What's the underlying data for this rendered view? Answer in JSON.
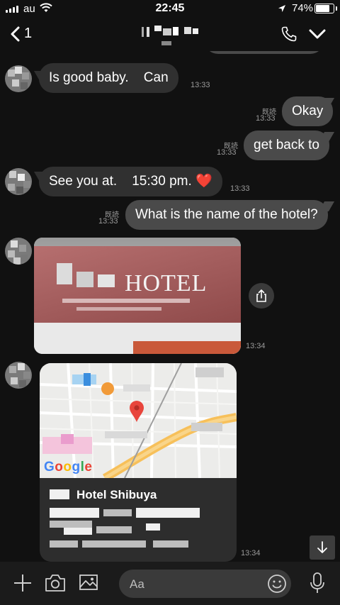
{
  "status_bar": {
    "carrier": "au",
    "time": "22:45",
    "battery": "74%"
  },
  "header": {
    "back_count": "1"
  },
  "messages": [
    {
      "side": "in",
      "text": "Is good baby.    Can",
      "time": "13:33"
    },
    {
      "side": "out",
      "text": "Okay",
      "time": "13:33",
      "read": "既読"
    },
    {
      "side": "out",
      "text": "get back to",
      "time": "13:33",
      "read": "既読"
    },
    {
      "side": "in",
      "text": "See you at.    15:30 pm. ❤️",
      "time": "13:33"
    },
    {
      "side": "out",
      "text": "What is the name of the hotel?",
      "time": "13:33",
      "read": "既読"
    }
  ],
  "photo": {
    "sign_text": "HOTEL",
    "time": "13:34"
  },
  "location": {
    "map_brand": "Google",
    "hotel_name": "Hotel Shibuya",
    "time": "13:34"
  },
  "input": {
    "placeholder": "Aa"
  },
  "icons": {
    "back": "chevron-left-icon",
    "call": "phone-icon",
    "menu": "chevron-down-icon",
    "share": "share-icon",
    "scroll": "arrow-down-icon",
    "add": "plus-icon",
    "camera": "camera-icon",
    "gallery": "image-icon",
    "emoji": "smiley-icon",
    "voice": "microphone-icon"
  },
  "colors": {
    "background": "#111111",
    "incoming_bubble": "#303030",
    "outgoing_bubble": "#4a4a4a",
    "pin": "#e8453c"
  }
}
